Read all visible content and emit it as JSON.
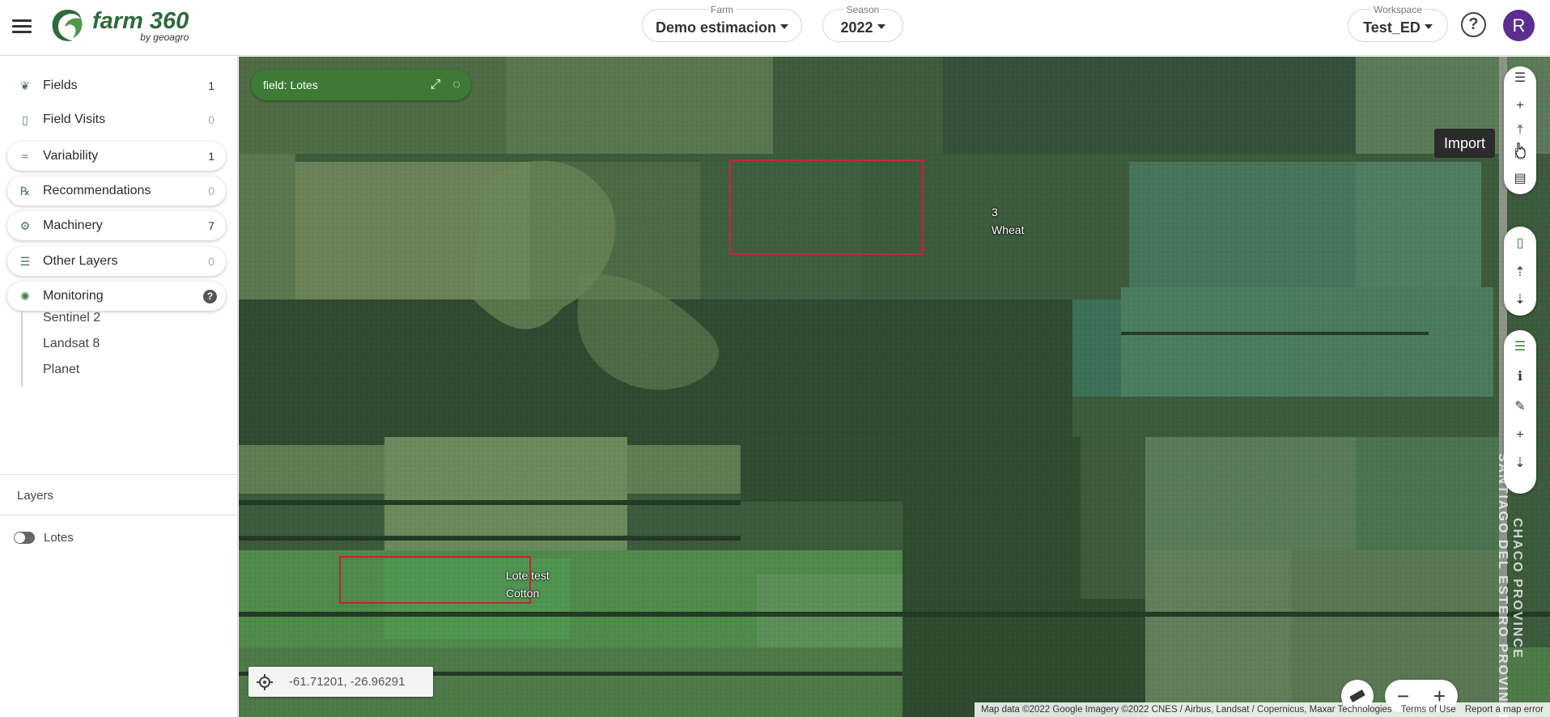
{
  "header": {
    "logo_title": "farm 360",
    "logo_sub": "by geoagro",
    "farm": {
      "label": "Farm",
      "value": "Demo estimacion"
    },
    "season": {
      "label": "Season",
      "value": "2022"
    },
    "workspace": {
      "label": "Workspace",
      "value": "Test_ED"
    },
    "help": "?",
    "avatar_initial": "R",
    "avatar_color": "#5b2d91"
  },
  "sidebar": {
    "items": [
      {
        "label": "Fields",
        "count": "1",
        "icon": "sprout-icon"
      },
      {
        "label": "Field Visits",
        "count": "0",
        "icon": "phone-icon"
      },
      {
        "label": "Variability",
        "count": "1",
        "icon": "variability-icon"
      },
      {
        "label": "Recommendations",
        "count": "0",
        "icon": "prescription-icon"
      },
      {
        "label": "Machinery",
        "count": "7",
        "icon": "tractor-icon"
      },
      {
        "label": "Other Layers",
        "count": "0",
        "icon": "layers-icon"
      },
      {
        "label": "Monitoring",
        "count": "",
        "icon": "satellite-icon"
      }
    ],
    "monitoring_sub": [
      "Sentinel 2",
      "Landsat 8",
      "Planet"
    ],
    "layers_title": "Layers",
    "layers": [
      {
        "name": "Lotes",
        "enabled": true
      }
    ]
  },
  "map": {
    "layer_chip": "field: Lotes",
    "fields": [
      {
        "name": "3",
        "crop": "Wheat"
      },
      {
        "name": "Lote test",
        "crop": "Cotton"
      }
    ],
    "tooltip": "Import",
    "coordinates": "-61.71201, -26.96291",
    "province_text_1": "SANTIAGO DEL ESTERO PROVINCE",
    "province_text_2": "CHACO PROVINCE",
    "attribution": {
      "data": "Map data ©2022 Google Imagery ©2022 CNES / Airbus, Landsat / Copernicus, Maxar Technologies",
      "terms": "Terms of Use",
      "report": "Report a map error"
    },
    "accent_green": "#3d7a36",
    "field_outline": "#c0283a"
  }
}
